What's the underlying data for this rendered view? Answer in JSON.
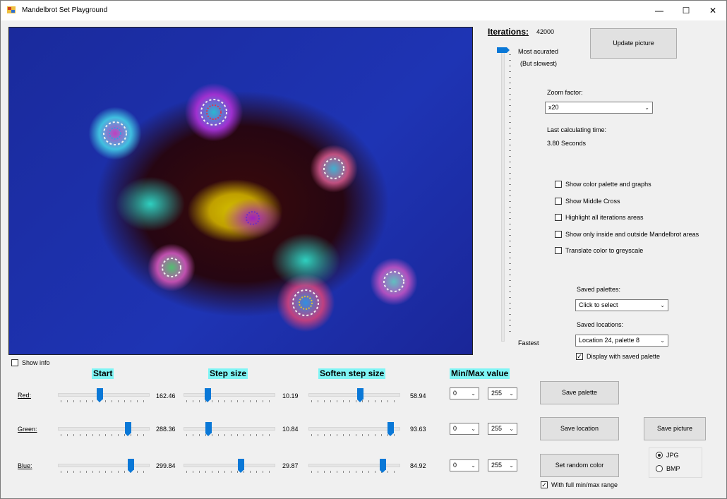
{
  "window": {
    "title": "Mandelbrot Set Playground",
    "minimize": "—",
    "maximize": "☐",
    "close": "✕"
  },
  "iterations": {
    "label": "Iterations:",
    "value": "42000",
    "top_label": "Most acurated",
    "top_sublabel": "(But slowest)",
    "bottom_label": "Fastest",
    "level": 1.0
  },
  "update_button": "Update picture",
  "zoom": {
    "label": "Zoom factor:",
    "value": "x20"
  },
  "calc_time": {
    "label": "Last calculating time:",
    "value": "3.80 Seconds"
  },
  "options": [
    {
      "label": "Show color palette and graphs",
      "checked": false
    },
    {
      "label": "Show Middle Cross",
      "checked": false
    },
    {
      "label": "Highlight all iterations areas",
      "checked": false
    },
    {
      "label": "Show only inside and outside Mandelbrot areas",
      "checked": false
    },
    {
      "label": "Translate color to greyscale",
      "checked": false
    }
  ],
  "saved_palettes": {
    "label": "Saved palettes:",
    "value": "Click to select"
  },
  "saved_locations": {
    "label": "Saved locations:",
    "value": "Location 24, palette 8"
  },
  "display_saved_palette": {
    "label": "Display with saved palette",
    "checked": true
  },
  "show_info": {
    "label": "Show info",
    "checked": false
  },
  "headers": {
    "start": "Start",
    "step": "Step size",
    "soften": "Soften step size",
    "minmax": "Min/Max value"
  },
  "channels": [
    {
      "name": "Red:",
      "start": "162.46",
      "step": "10.19",
      "soften": "58.94",
      "min": "0",
      "max": "255",
      "start_level": 0.46,
      "step_level": 0.25,
      "soften_level": 0.58
    },
    {
      "name": "Green:",
      "start": "288.36",
      "step": "10.84",
      "soften": "93.63",
      "min": "0",
      "max": "255",
      "start_level": 0.8,
      "step_level": 0.26,
      "soften_level": 0.94
    },
    {
      "name": "Blue:",
      "start": "299.84",
      "step": "29.87",
      "soften": "84.92",
      "min": "0",
      "max": "255",
      "start_level": 0.83,
      "step_level": 0.65,
      "soften_level": 0.85
    }
  ],
  "buttons": {
    "save_palette": "Save  palette",
    "save_location": "Save location",
    "save_picture": "Save picture",
    "random_color": "Set random color"
  },
  "full_range": {
    "label": "With full min/max range",
    "checked": true
  },
  "format": {
    "options": [
      "JPG",
      "BMP"
    ],
    "selected": "JPG"
  }
}
